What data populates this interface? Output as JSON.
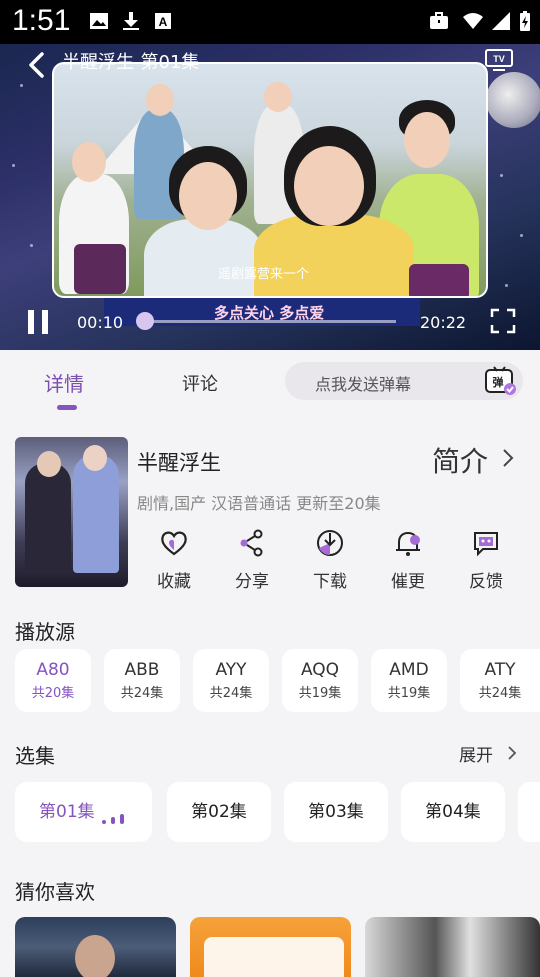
{
  "status_bar": {
    "time": "1:51"
  },
  "player": {
    "title": "半醒浮生-第01集",
    "subtitle": "遥剧露营来一个",
    "banner_text": "多点关心 多点爱",
    "current_time": "00:10",
    "total_time": "20:22",
    "progress": 0.008
  },
  "tabs": [
    {
      "label": "详情"
    },
    {
      "label": "评论"
    }
  ],
  "danmu": {
    "placeholder": "点我发送弹幕",
    "icon_text": "弹"
  },
  "show": {
    "title": "半醒浮生",
    "intro_label": "简介",
    "meta": "剧情,国产 汉语普通话 更新至20集"
  },
  "actions": [
    {
      "label": "收藏",
      "icon": "heart-icon"
    },
    {
      "label": "分享",
      "icon": "share-icon"
    },
    {
      "label": "下载",
      "icon": "download-icon"
    },
    {
      "label": "催更",
      "icon": "bell-icon"
    },
    {
      "label": "反馈",
      "icon": "feedback-icon"
    }
  ],
  "sources_title": "播放源",
  "sources": [
    {
      "name": "A80",
      "count": "共20集"
    },
    {
      "name": "ABB",
      "count": "共24集"
    },
    {
      "name": "AYY",
      "count": "共24集"
    },
    {
      "name": "AQQ",
      "count": "共19集"
    },
    {
      "name": "AMD",
      "count": "共19集"
    },
    {
      "name": "ATY",
      "count": "共24集"
    }
  ],
  "episodes_title": "选集",
  "expand_label": "展开",
  "episodes": [
    "第01集",
    "第02集",
    "第03集",
    "第04集"
  ],
  "recommend_title": "猜你喜欢",
  "colors": {
    "accent": "#8554c0",
    "background": "#f4f3f6"
  }
}
